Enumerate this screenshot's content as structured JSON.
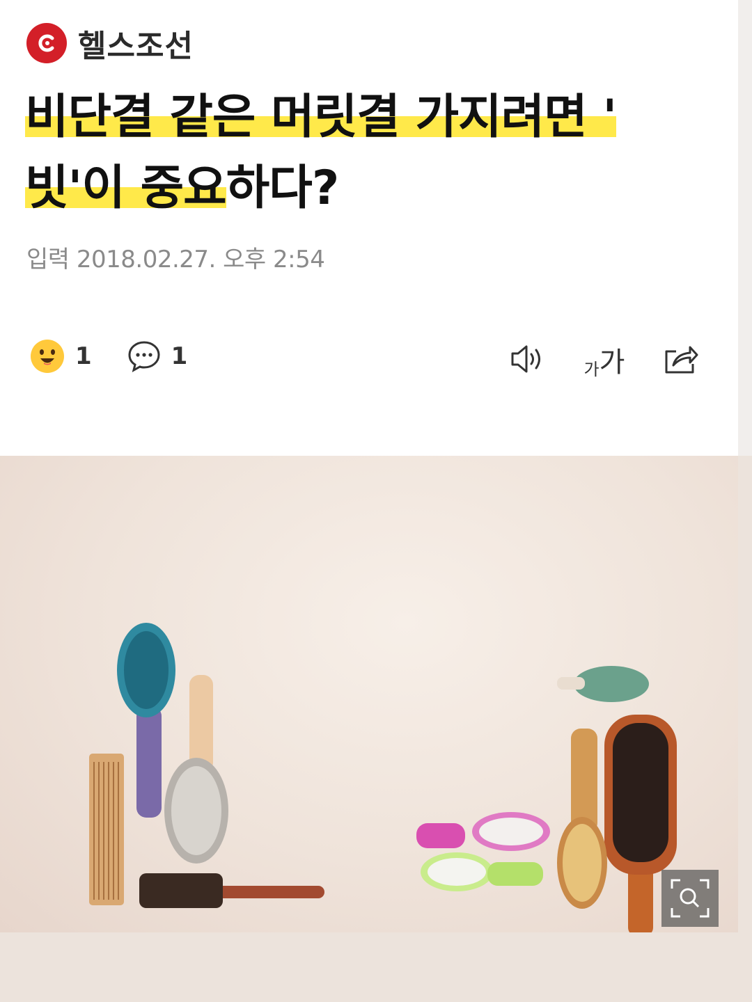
{
  "brand": {
    "name": "헬스조선",
    "logo_icon": "chosun-logo-icon",
    "color": "#d31f28"
  },
  "article": {
    "title_line1": "비단결 같은 머릿결 가지려면 '",
    "title_line2_hl": "빗'이 중요",
    "title_line2_rest": "하다?",
    "dateline": "입력 2018.02.27. 오후 2:54"
  },
  "reactions": {
    "emoji_count": "1",
    "comment_count": "1"
  },
  "tools": {
    "tts_icon": "speaker-icon",
    "fontsize_small": "가",
    "fontsize_large": "가",
    "share_icon": "share-icon"
  },
  "image": {
    "subject": "hair brushes and combs",
    "zoom_icon": "zoom-icon"
  },
  "colors": {
    "highlight": "#ffe94a",
    "background": "#ece3dc"
  }
}
